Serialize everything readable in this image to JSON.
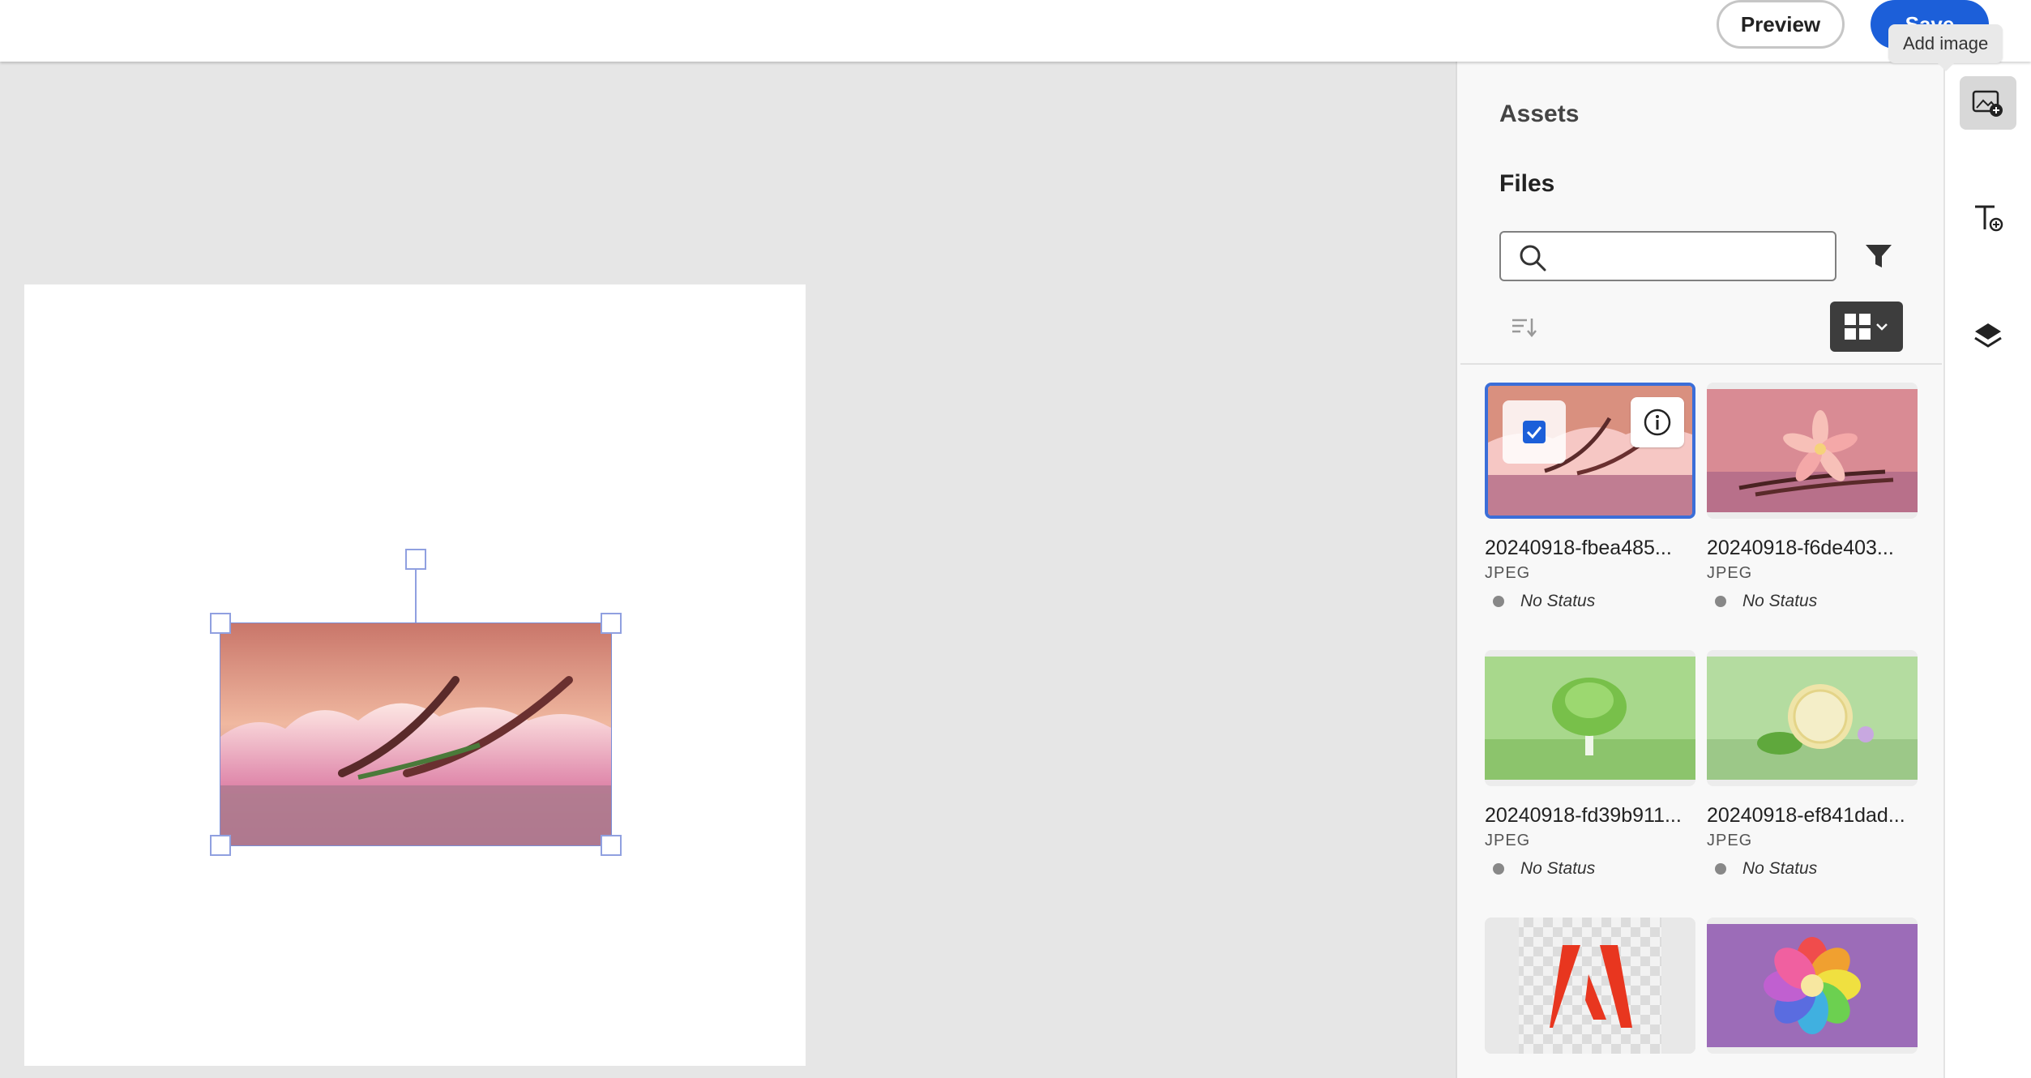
{
  "header": {
    "preview_label": "Preview",
    "save_label": "Save"
  },
  "tooltip": {
    "text": "Add image"
  },
  "panel": {
    "title": "Assets",
    "section": "Files",
    "search": {
      "value": "",
      "placeholder": ""
    }
  },
  "assets": [
    {
      "name": "20240918-fbea485...",
      "type": "JPEG",
      "status": "No Status",
      "selected": true
    },
    {
      "name": "20240918-f6de403...",
      "type": "JPEG",
      "status": "No Status",
      "selected": false
    },
    {
      "name": "20240918-fd39b911...",
      "type": "JPEG",
      "status": "No Status",
      "selected": false
    },
    {
      "name": "20240918-ef841dad...",
      "type": "JPEG",
      "status": "No Status",
      "selected": false
    },
    {
      "name": "",
      "type": "",
      "status": "",
      "selected": false
    },
    {
      "name": "",
      "type": "",
      "status": "",
      "selected": false
    }
  ],
  "rail": {
    "items": [
      {
        "icon": "add-image-icon",
        "active": true
      },
      {
        "icon": "add-text-icon",
        "active": false
      },
      {
        "icon": "layers-icon",
        "active": false
      }
    ]
  },
  "colors": {
    "accent": "#1c5fd9",
    "selection": "#3b6ed8",
    "status_dot": "#888888"
  }
}
